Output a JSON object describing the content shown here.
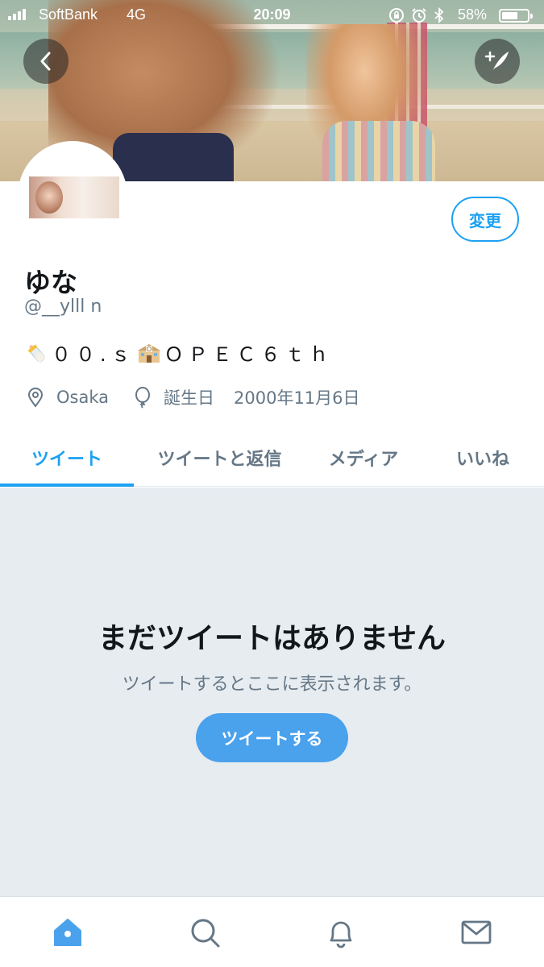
{
  "status_bar": {
    "carrier": "SoftBank",
    "network": "4G",
    "time": "20:09",
    "battery": "58%",
    "icons": [
      "orientation-lock-icon",
      "alarm-icon",
      "bluetooth-icon",
      "battery-icon"
    ]
  },
  "header": {
    "back_icon": "chevron-left-icon",
    "compose_icon": "compose-tweet-icon"
  },
  "profile": {
    "name": "ゆな",
    "handle": "@__ylll n",
    "bio_part1": "００.ｓ",
    "bio_part2": "ＯＰＥＣ６ｔｈ",
    "bio_emojis": [
      "baby-bottle-emoji",
      "school-emoji"
    ],
    "location": "Osaka",
    "birthday_label": "誕生日",
    "birthday": "2000年11月6日",
    "edit_button": "変更"
  },
  "tabs": [
    {
      "label": "ツイート",
      "active": true
    },
    {
      "label": "ツイートと返信",
      "active": false
    },
    {
      "label": "メディア",
      "active": false
    },
    {
      "label": "いいね",
      "active": false
    }
  ],
  "empty_state": {
    "title": "まだツイートはありません",
    "subtitle": "ツイートするとここに表示されます。",
    "button": "ツイートする"
  },
  "bottom_nav": [
    "home-icon",
    "search-icon",
    "notifications-icon",
    "messages-icon"
  ],
  "colors": {
    "accent": "#1da1f2",
    "button": "#4aa1ec",
    "muted": "#657786",
    "empty_bg": "#e6ecf0"
  }
}
